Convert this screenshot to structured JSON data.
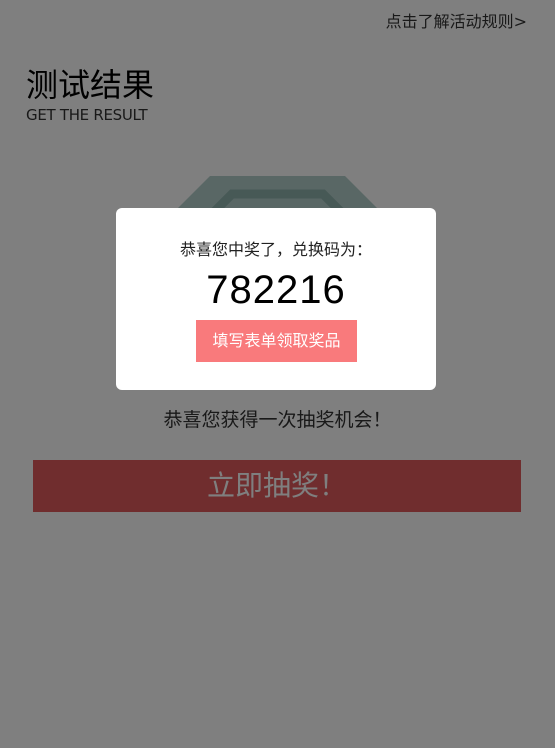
{
  "header": {
    "rules_link_label": "点击了解活动规则>"
  },
  "result": {
    "title": "测试结果",
    "subtitle": "GET THE RESULT"
  },
  "badge": {
    "icon": "octagon-badge-icon",
    "outer_color": "#b3cfcb",
    "inner_color": "#9bbcb7"
  },
  "main": {
    "chance_text": "恭喜您获得一次抽奖机会！",
    "draw_button_label": "立即抽奖！",
    "draw_button_color": "#e05a5c"
  },
  "modal": {
    "message": "恭喜您中奖了，兑换码为：",
    "code": "782216",
    "form_button_label": "填写表单领取奖品",
    "form_button_color": "#f97a7c"
  }
}
